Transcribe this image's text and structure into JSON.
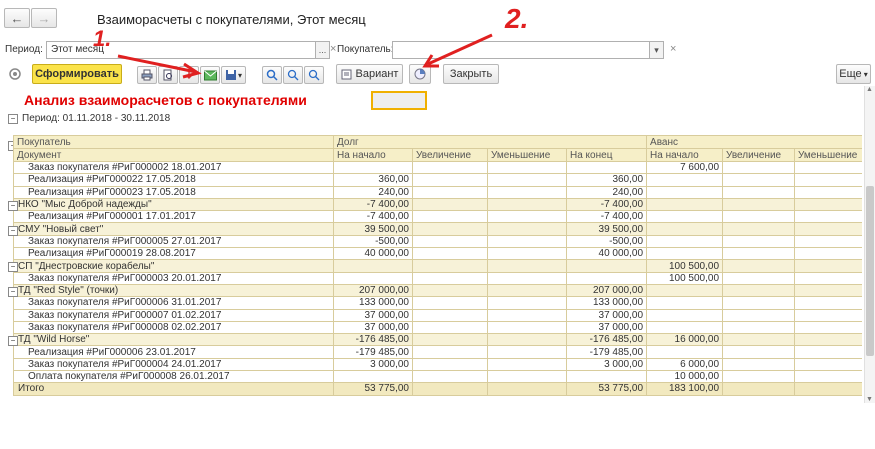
{
  "window": {
    "title": "Взаиморасчеты с покупателями, Этот месяц"
  },
  "nav": {
    "back_icon": "←",
    "forward_icon": "→"
  },
  "filters": {
    "period_label": "Период:",
    "period_value": "Этот месяц",
    "period_more": "...",
    "period_clear": "×",
    "customer_label": "Покупатель:",
    "customer_value": "",
    "customer_dropdown": "▾",
    "customer_clear": "×"
  },
  "toolbar": {
    "generate_label": "Сформировать",
    "variant_label": "Вариант",
    "close_label": "Закрыть",
    "more_label": "Еще",
    "more_arrow": "▾"
  },
  "annotations": {
    "one": "1.",
    "two": "2."
  },
  "report": {
    "title": "Анализ взаиморасчетов с покупателями",
    "period": "Период: 01.11.2018 - 30.11.2018",
    "group_headers": [
      "Покупатель",
      "Долг",
      "Аванс"
    ],
    "columns": [
      "Документ",
      "На начало",
      "Увеличение",
      "Уменьшение",
      "На конец",
      "На начало",
      "Увеличение",
      "Уменьшение"
    ],
    "rows": [
      {
        "type": "detail",
        "cells": [
          "Заказ покупателя #РиГ000002 18.01.2017",
          "",
          "",
          "",
          "",
          "7 600,00",
          "",
          ""
        ]
      },
      {
        "type": "detail",
        "cells": [
          "Реализация #РиГ000022 17.05.2018",
          "360,00",
          "",
          "",
          "360,00",
          "",
          "",
          ""
        ]
      },
      {
        "type": "detail",
        "cells": [
          "Реализация #РиГ000023 17.05.2018",
          "240,00",
          "",
          "",
          "240,00",
          "",
          "",
          ""
        ]
      },
      {
        "type": "group",
        "cells": [
          "НКО \"Мыс Доброй надежды\"",
          "-7 400,00",
          "",
          "",
          "-7 400,00",
          "",
          "",
          ""
        ]
      },
      {
        "type": "detail",
        "cells": [
          "Реализация #РиГ000001 17.01.2017",
          "-7 400,00",
          "",
          "",
          "-7 400,00",
          "",
          "",
          ""
        ]
      },
      {
        "type": "group",
        "cells": [
          "СМУ \"Новый свет\"",
          "39 500,00",
          "",
          "",
          "39 500,00",
          "",
          "",
          ""
        ]
      },
      {
        "type": "detail",
        "cells": [
          "Заказ покупателя #РиГ000005 27.01.2017",
          "-500,00",
          "",
          "",
          "-500,00",
          "",
          "",
          ""
        ]
      },
      {
        "type": "detail",
        "cells": [
          "Реализация #РиГ000019 28.08.2017",
          "40 000,00",
          "",
          "",
          "40 000,00",
          "",
          "",
          ""
        ]
      },
      {
        "type": "group",
        "cells": [
          "СП \"Днестровские корабелы\"",
          "",
          "",
          "",
          "",
          "100 500,00",
          "",
          ""
        ]
      },
      {
        "type": "detail",
        "cells": [
          "Заказ покупателя #РиГ000003 20.01.2017",
          "",
          "",
          "",
          "",
          "100 500,00",
          "",
          ""
        ]
      },
      {
        "type": "group",
        "cells": [
          "ТД \"Red Style\" (точки)",
          "207 000,00",
          "",
          "",
          "207 000,00",
          "",
          "",
          ""
        ]
      },
      {
        "type": "detail",
        "cells": [
          "Заказ покупателя #РиГ000006 31.01.2017",
          "133 000,00",
          "",
          "",
          "133 000,00",
          "",
          "",
          ""
        ]
      },
      {
        "type": "detail",
        "cells": [
          "Заказ покупателя #РиГ000007 01.02.2017",
          "37 000,00",
          "",
          "",
          "37 000,00",
          "",
          "",
          ""
        ]
      },
      {
        "type": "detail",
        "cells": [
          "Заказ покупателя #РиГ000008 02.02.2017",
          "37 000,00",
          "",
          "",
          "37 000,00",
          "",
          "",
          ""
        ]
      },
      {
        "type": "group",
        "cells": [
          "ТД \"Wild Horse\"",
          "-176 485,00",
          "",
          "",
          "-176 485,00",
          "16 000,00",
          "",
          ""
        ]
      },
      {
        "type": "detail",
        "cells": [
          "Реализация #РиГ000006 23.01.2017",
          "-179 485,00",
          "",
          "",
          "-179 485,00",
          "",
          "",
          ""
        ]
      },
      {
        "type": "detail",
        "cells": [
          "Заказ покупателя #РиГ000004 24.01.2017",
          "3 000,00",
          "",
          "",
          "3 000,00",
          "6 000,00",
          "",
          ""
        ]
      },
      {
        "type": "detail",
        "cells": [
          "Оплата покупателя #РиГ000008 26.01.2017",
          "",
          "",
          "",
          "",
          "10 000,00",
          "",
          ""
        ]
      },
      {
        "type": "total",
        "cells": [
          "Итого",
          "53 775,00",
          "",
          "",
          "53 775,00",
          "183 100,00",
          "",
          ""
        ]
      }
    ]
  }
}
